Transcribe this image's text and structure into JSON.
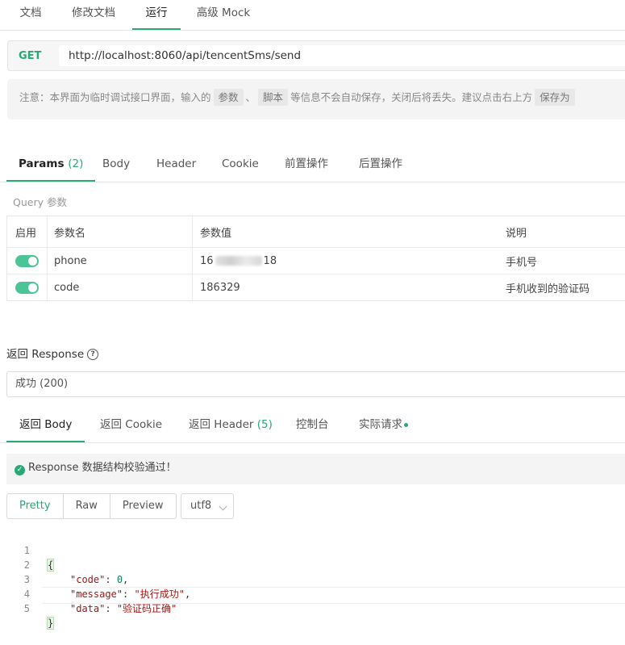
{
  "top_tabs": [
    "文档",
    "修改文档",
    "运行",
    "高级 Mock"
  ],
  "request": {
    "method": "GET",
    "url": "http://localhost:8060/api/tencentSms/send"
  },
  "notice": {
    "prefix": "注意：本界面为临时调试接口界面，输入的",
    "tag1": "参数",
    "sep": "、",
    "tag2": "脚本",
    "suffix": "等信息不会自动保存，关闭后将丢失。建议点击右上方",
    "tag3": "保存为"
  },
  "param_tabs": {
    "params_label": "Params",
    "params_count": "(2)",
    "body": "Body",
    "header": "Header",
    "cookie": "Cookie",
    "pre": "前置操作",
    "post": "后置操作"
  },
  "query_label": "Query 参数",
  "table": {
    "headers": {
      "enabled": "启用",
      "name": "参数名",
      "value": "参数值",
      "desc": "说明"
    },
    "rows": [
      {
        "name": "phone",
        "value_start": "16",
        "value_end": "18",
        "desc": "手机号",
        "enabled": true
      },
      {
        "name": "code",
        "value": "186329",
        "desc": "手机收到的验证码",
        "enabled": true
      }
    ]
  },
  "response": {
    "label": "返回 Response",
    "status": "成功 (200)"
  },
  "resp_tabs": {
    "body": "返回 Body",
    "cookie": "返回 Cookie",
    "header_label": "返回 Header",
    "header_count": "(5)",
    "console": "控制台",
    "actual": "实际请求"
  },
  "validation": "Response 数据结构校验通过！",
  "view_modes": [
    "Pretty",
    "Raw",
    "Preview"
  ],
  "encoding": "utf8",
  "code": {
    "line_numbers": [
      "1",
      "2",
      "3",
      "4",
      "5"
    ],
    "open": "{",
    "close": "}",
    "entries": [
      {
        "key": "\"code\"",
        "value": "0"
      },
      {
        "key": "\"message\"",
        "value": "\"执行成功\""
      },
      {
        "key": "\"data\"",
        "value": "\"验证码正确\""
      }
    ]
  },
  "colors": {
    "accent": "#2aa876"
  }
}
